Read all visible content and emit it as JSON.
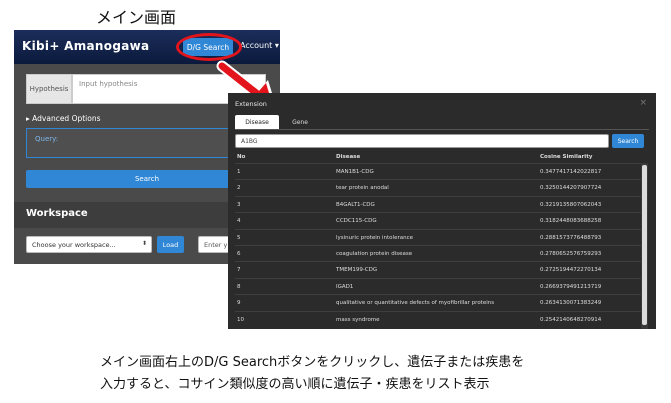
{
  "captions": {
    "top": "メイン画面",
    "bottom_line1": "メイン画面右上のD/G Searchボタンをクリックし、遺伝子または疾患を",
    "bottom_line2": "入力すると、コサイン類似度の高い順に遺伝子・疾患をリスト表示"
  },
  "main_screen": {
    "logo": "Kibi+ Amanogawa",
    "dg_search_label": "D/G Search",
    "account_label": "Account ▾",
    "hypothesis_label": "Hypothesis",
    "hypothesis_placeholder": "Input hypothesis",
    "advanced_options": "▸ Advanced Options",
    "query_label": "Query:",
    "search_label": "Search",
    "workspace_title": "Workspace",
    "workspace_select": "Choose your workspace...",
    "workspace_caret": "⬍",
    "load_label": "Load",
    "enter_placeholder": "Enter y"
  },
  "extension": {
    "title": "Extension",
    "close": "×",
    "tabs": [
      "Disease",
      "Gene"
    ],
    "active_tab": "Disease",
    "input_value": "A1BG",
    "search_label": "Search",
    "columns": [
      "No",
      "Disease",
      "Cosine Similarity"
    ],
    "rows": [
      {
        "no": "1",
        "disease": "MAN1B1-CDG",
        "cos": "0.3477417142022817"
      },
      {
        "no": "2",
        "disease": "tear protein anodal",
        "cos": "0.3250144207907724"
      },
      {
        "no": "3",
        "disease": "B4GALT1-CDG",
        "cos": "0.3219135807062043"
      },
      {
        "no": "4",
        "disease": "CCDC115-CDG",
        "cos": "0.3182448083688258"
      },
      {
        "no": "5",
        "disease": "lysinuric protein intolerance",
        "cos": "0.2881573776488793"
      },
      {
        "no": "6",
        "disease": "coagulation protein disease",
        "cos": "0.2780652576759293"
      },
      {
        "no": "7",
        "disease": "TMEM199-CDG",
        "cos": "0.2725194472270134"
      },
      {
        "no": "8",
        "disease": "IGAD1",
        "cos": "0.2669379491213719"
      },
      {
        "no": "9",
        "disease": "qualitative or quantitative defects of myofibrillar proteins",
        "cos": "0.2634130071383249"
      },
      {
        "no": "10",
        "disease": "mass syndrome",
        "cos": "0.2542140648270914"
      }
    ]
  },
  "colors": {
    "accent_blue": "#2f87d6",
    "highlight_red": "#e3141b",
    "nav_dark": "#0b1a3c"
  }
}
